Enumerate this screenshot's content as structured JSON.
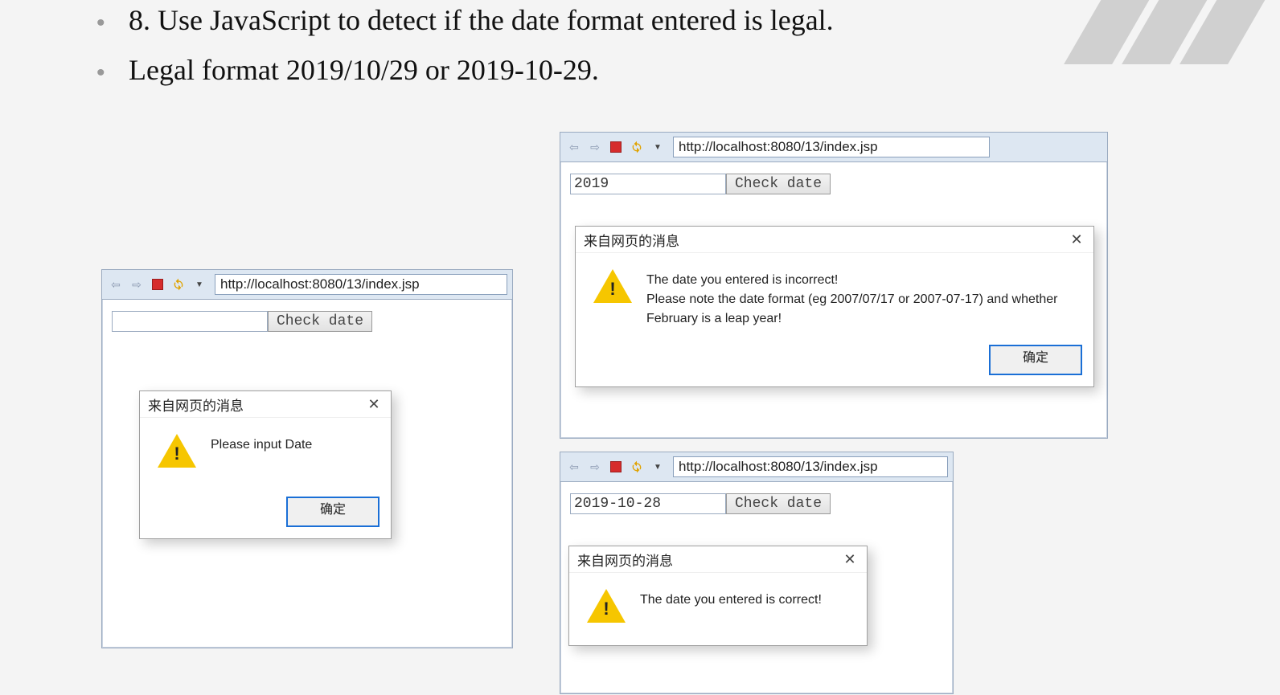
{
  "bullets": {
    "line1": "8. Use JavaScript to detect if the date format entered is legal.",
    "line2": "Legal format 2019/10/29 or 2019-10-29."
  },
  "shared": {
    "url": "http://localhost:8080/13/index.jsp",
    "check_label": "Check date",
    "alert_title": "来自网页的消息",
    "ok_label": "确定"
  },
  "scr1": {
    "input_value": "",
    "alert_msg": "Please input Date"
  },
  "scr2": {
    "input_value": "2019",
    "alert_line1": "The date you entered is incorrect!",
    "alert_line2": " Please note the date format (eg 2007/07/17 or 2007-07-17) and whether February is a leap year!"
  },
  "scr3": {
    "input_value": "2019-10-28",
    "alert_msg": "The date you entered is correct!"
  }
}
